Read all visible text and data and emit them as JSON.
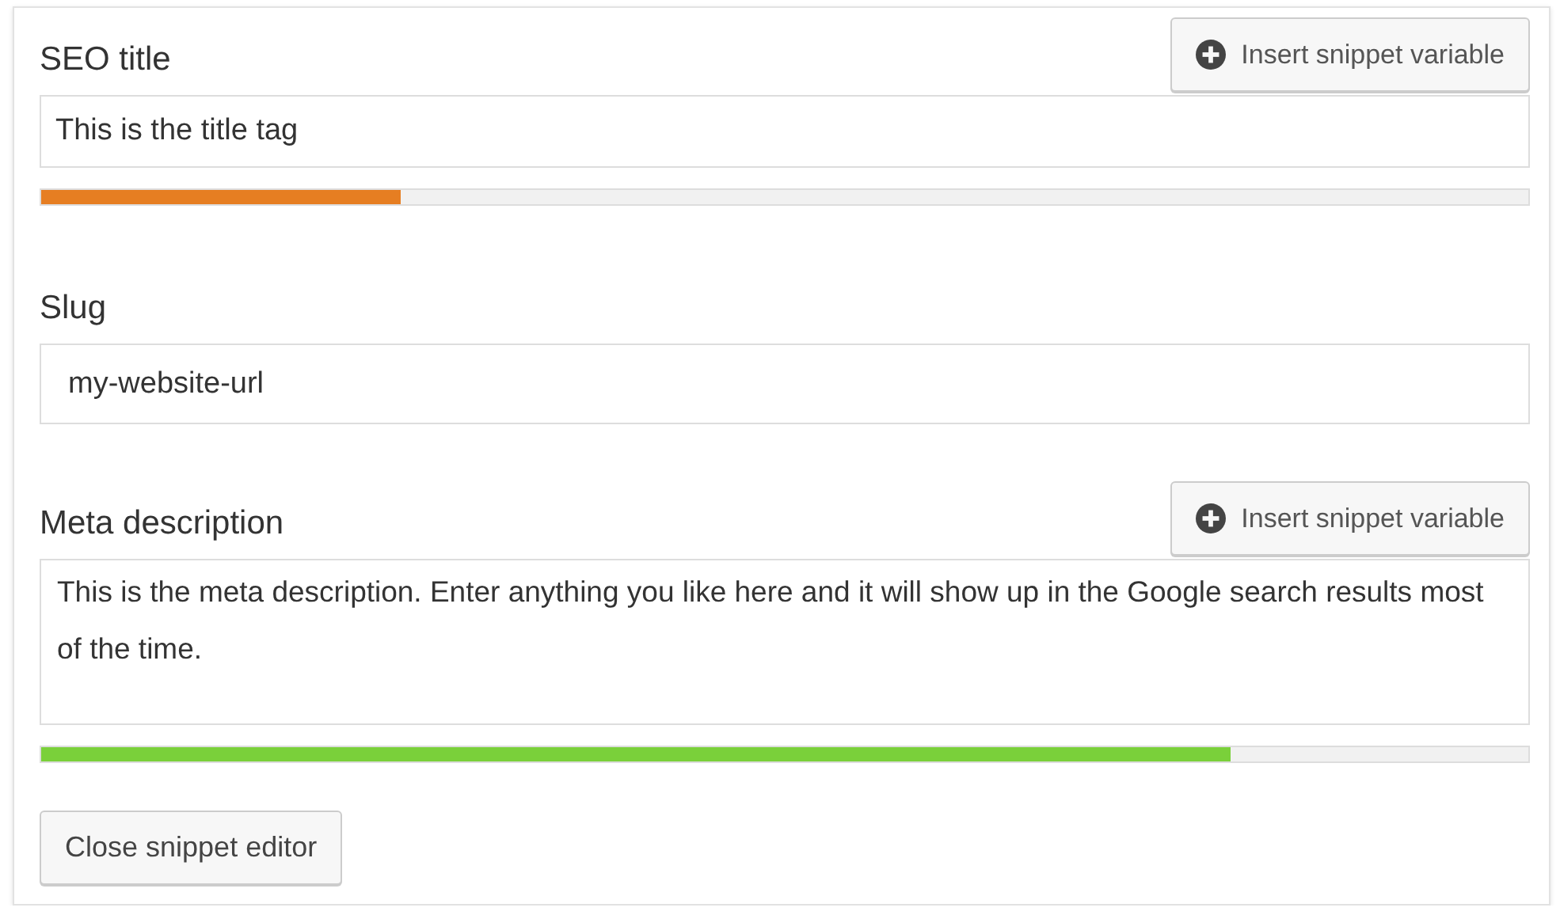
{
  "fields": [
    {
      "kind": "input",
      "label": "SEO title",
      "button": "Insert snippet variable",
      "value": "This is the title tag",
      "meter": {
        "level": 0.242,
        "color": "#e67e22"
      }
    },
    {
      "kind": "input",
      "label": "Slug",
      "value": "my-website-url"
    },
    {
      "kind": "textarea",
      "label": "Meta description",
      "button": "Insert snippet variable",
      "value": "This is the meta description. Enter anything you like here and it will show up in the Google search results most of the time.",
      "meter": {
        "level": 0.8,
        "color": "#7ad03a"
      }
    }
  ],
  "close_button": "Close snippet editor"
}
